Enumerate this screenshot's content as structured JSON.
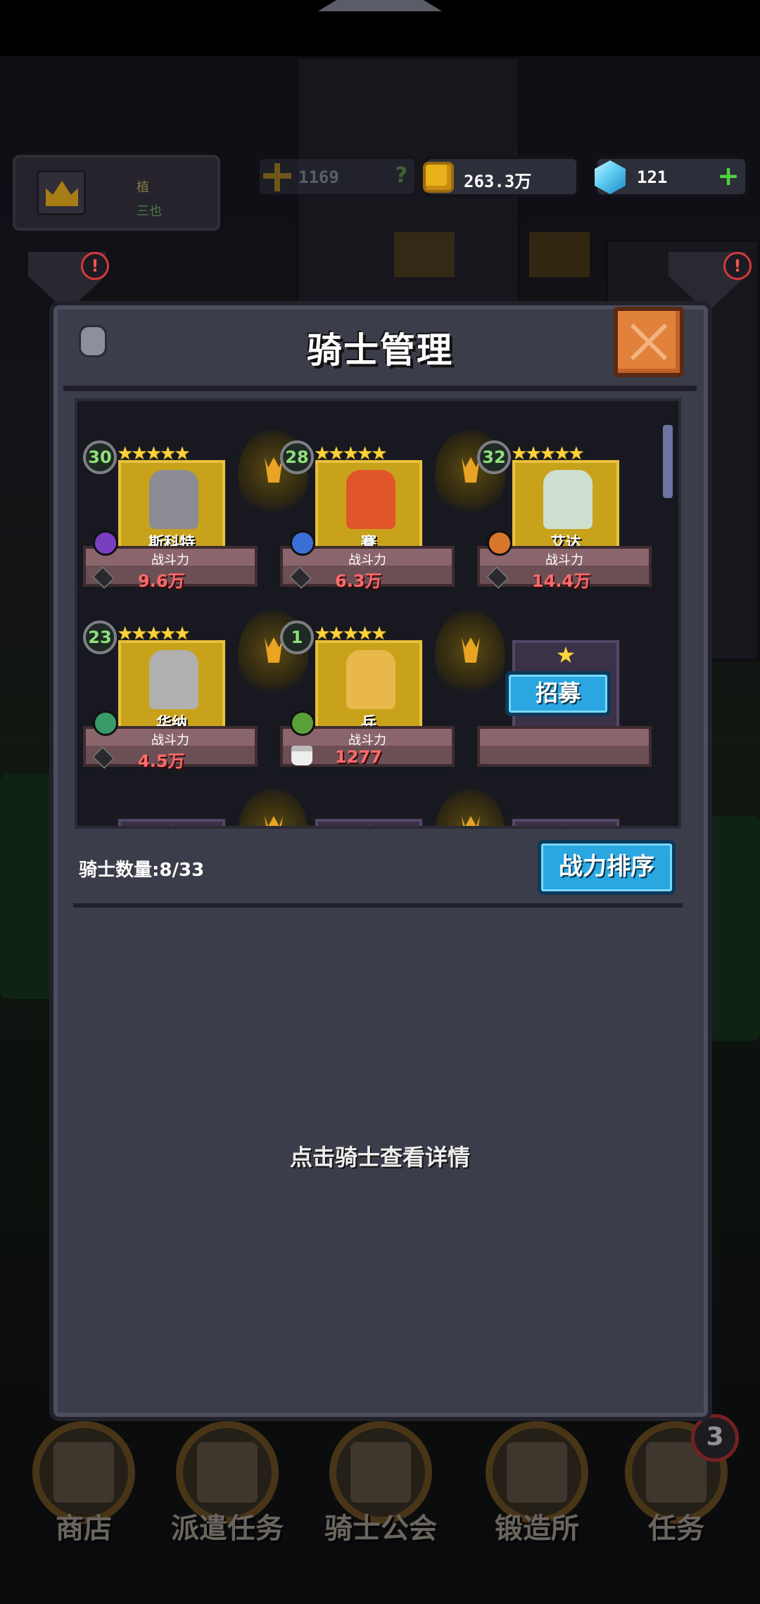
{
  "hud": {
    "player_rank": "植",
    "player_sub": "三也",
    "power": "1169",
    "help_label": "?",
    "gold": "263.3万",
    "gems": "121",
    "plus_label": "+",
    "alert_mark": "!"
  },
  "dialog": {
    "title": "骑士管理",
    "stat_label": "战斗力",
    "recruit_label": "招募",
    "count_label": "骑士数量:8/33",
    "sort_label": "战力排序",
    "detail_hint": "点击骑士查看详情"
  },
  "knights": [
    {
      "level": "30",
      "stars": "★★★★★",
      "name": "斯科特",
      "power": "9.6万",
      "stat_icon": "sword-icon",
      "element_color": "#7a3ec0",
      "figure_color": "#8b8b94"
    },
    {
      "level": "28",
      "stars": "★★★★★",
      "name": "賽",
      "power": "6.3万",
      "stat_icon": "sword-icon",
      "element_color": "#3b6fd8",
      "figure_color": "#e0552a"
    },
    {
      "level": "32",
      "stars": "★★★★★",
      "name": "艾达",
      "power": "14.4万",
      "stat_icon": "sword-icon",
      "element_color": "#d8762a",
      "figure_color": "#cfe0d0"
    },
    {
      "level": "23",
      "stars": "★★★★★",
      "name": "华纳",
      "power": "4.5万",
      "stat_icon": "sword-icon",
      "element_color": "#3a9a6a",
      "figure_color": "#b0b0b0"
    },
    {
      "level": "1",
      "stars": "★★★★★",
      "name": "兵",
      "power": "1277",
      "stat_icon": "cake-icon",
      "element_color": "#5aa03a",
      "figure_color": "#e8b84a"
    }
  ],
  "empty_slot": {
    "stars": "★"
  },
  "bottom_nav": [
    {
      "label": "商店"
    },
    {
      "label": "派遣任务"
    },
    {
      "label": "骑士公会"
    },
    {
      "label": "锻造所"
    },
    {
      "label": "任务",
      "badge": "3"
    }
  ]
}
